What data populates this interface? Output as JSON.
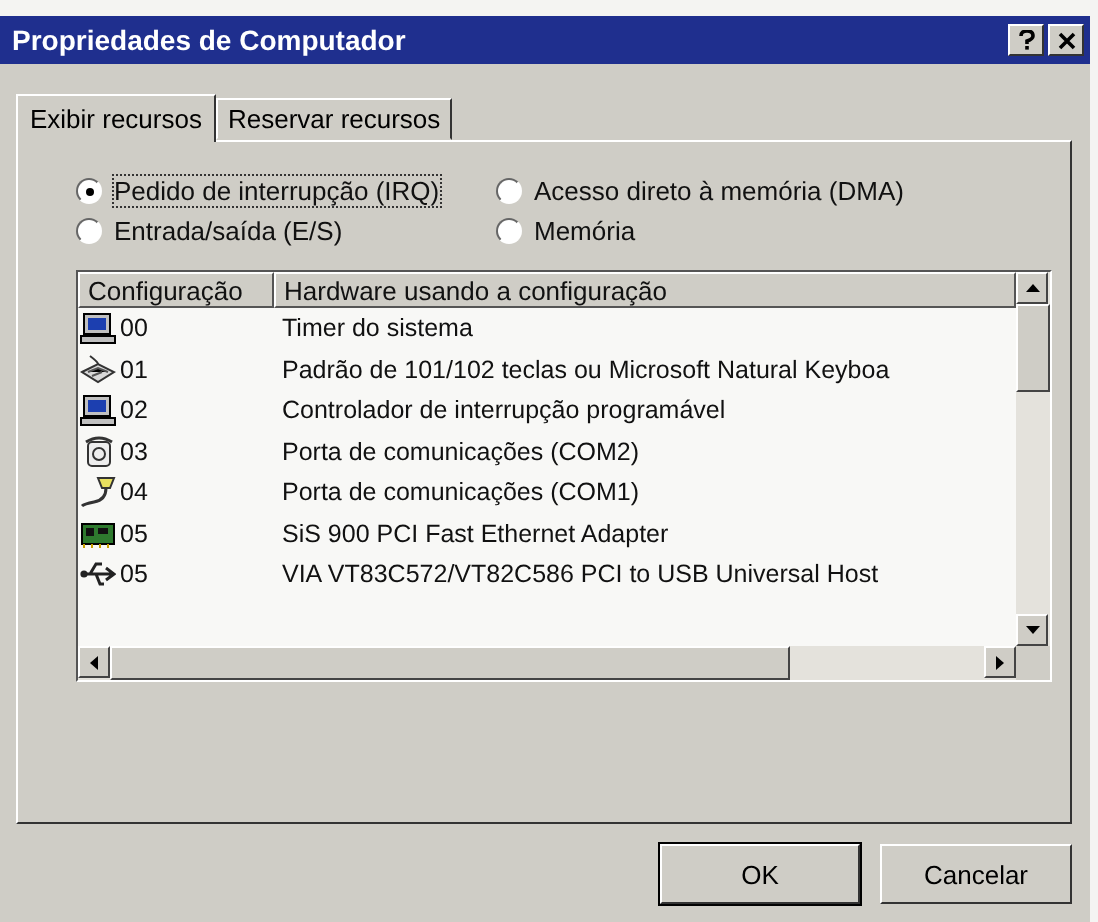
{
  "window": {
    "title": "Propriedades de Computador"
  },
  "tabs": [
    {
      "label": "Exibir recursos",
      "selected": true
    },
    {
      "label": "Reservar recursos",
      "selected": false
    }
  ],
  "view_options": [
    {
      "label": "Pedido de interrupção (IRQ)",
      "selected": true
    },
    {
      "label": "Acesso direto à memória (DMA)",
      "selected": false
    },
    {
      "label": "Entrada/saída (E/S)",
      "selected": false
    },
    {
      "label": "Memória",
      "selected": false
    }
  ],
  "table": {
    "columns": [
      "Configuração",
      "Hardware usando a configuração"
    ],
    "rows": [
      {
        "kind": "computer",
        "setting": "00",
        "hardware": "Timer do sistema"
      },
      {
        "kind": "keyboard",
        "setting": "01",
        "hardware": "Padrão de 101/102 teclas ou Microsoft Natural Keyboa"
      },
      {
        "kind": "computer",
        "setting": "02",
        "hardware": "Controlador de interrupção programável"
      },
      {
        "kind": "modem",
        "setting": "03",
        "hardware": "Porta de comunicações (COM2)"
      },
      {
        "kind": "port",
        "setting": "04",
        "hardware": "Porta de comunicações (COM1)"
      },
      {
        "kind": "network",
        "setting": "05",
        "hardware": "SiS 900 PCI Fast Ethernet Adapter"
      },
      {
        "kind": "usb",
        "setting": "05",
        "hardware": "VIA VT83C572/VT82C586 PCI to USB Universal Host"
      }
    ]
  },
  "buttons": [
    "OK",
    "Cancelar"
  ]
}
